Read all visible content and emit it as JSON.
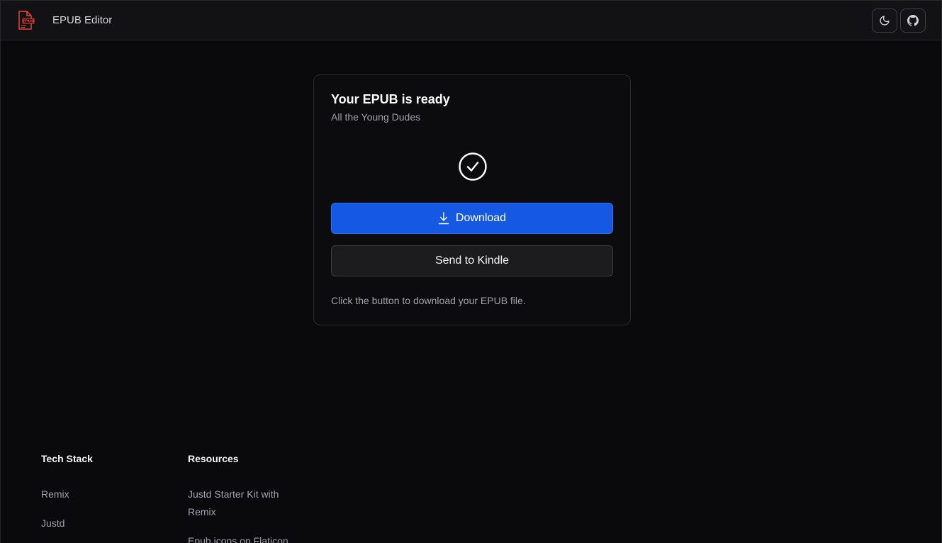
{
  "header": {
    "app_title": "EPUB Editor",
    "logo_text": "EPUB",
    "theme_icon": "moon-icon",
    "github_icon": "github-icon"
  },
  "card": {
    "title": "Your EPUB is ready",
    "subtitle": "All the Young Dudes",
    "status_icon": "check-circle-icon",
    "download_label": "Download",
    "kindle_label": "Send to Kindle",
    "hint": "Click the button to download your EPUB file."
  },
  "footer": {
    "tech_stack": {
      "heading": "Tech Stack",
      "links": [
        "Remix",
        "Justd"
      ]
    },
    "resources": {
      "heading": "Resources",
      "links": [
        "Justd Starter Kit with Remix",
        "Epub icons on Flaticon"
      ]
    }
  },
  "colors": {
    "background": "#0a0a0c",
    "primary": "#1558e3",
    "logo_accent": "#e8453c"
  }
}
